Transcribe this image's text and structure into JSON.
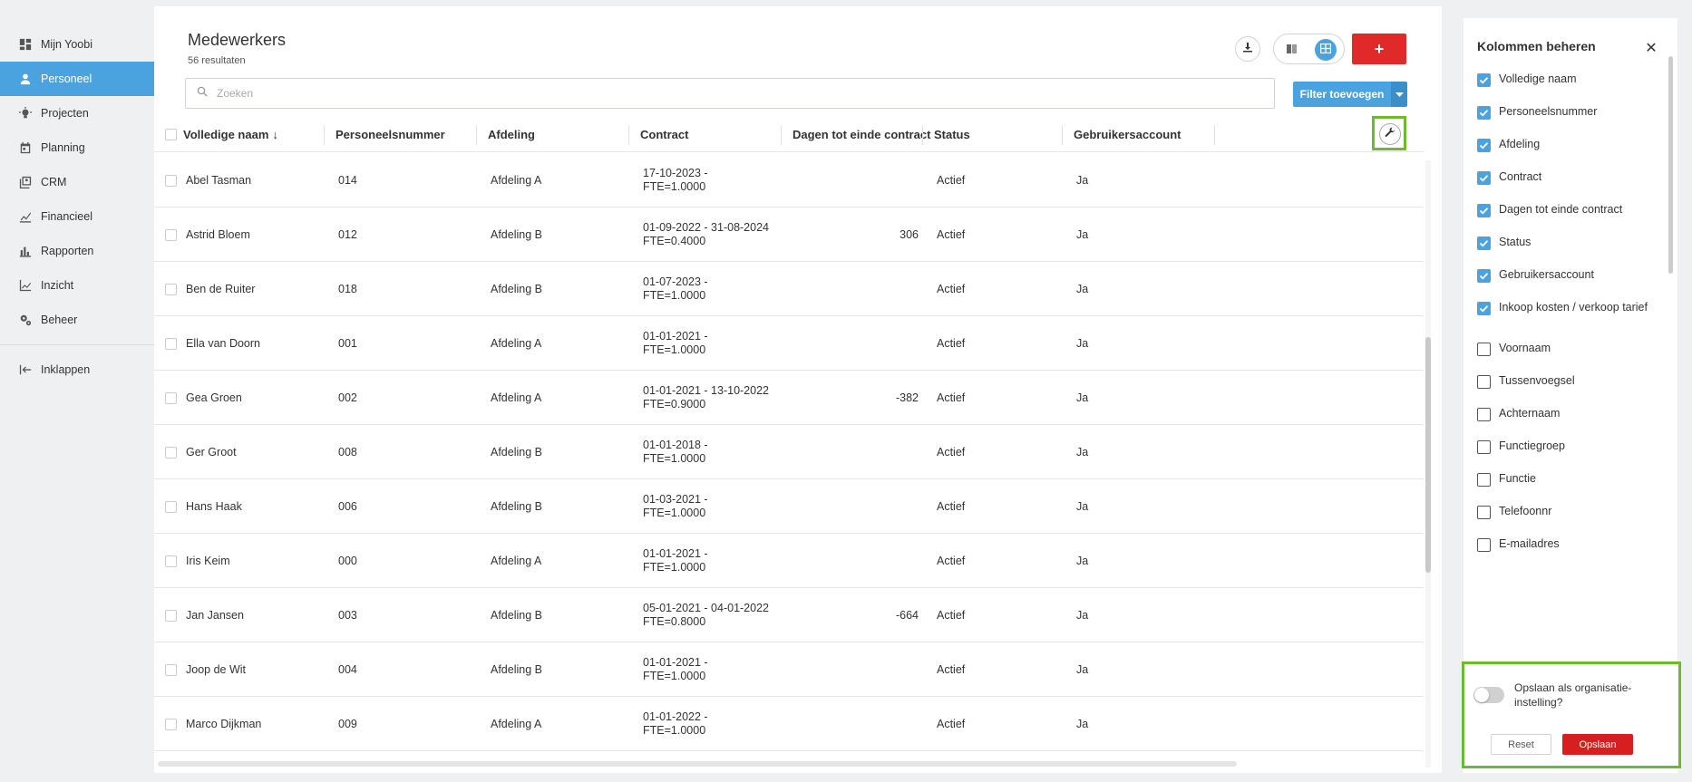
{
  "sidebar": {
    "items": [
      {
        "label": "Mijn Yoobi",
        "icon": "dashboard-icon"
      },
      {
        "label": "Personeel",
        "icon": "person-icon",
        "active": true
      },
      {
        "label": "Projecten",
        "icon": "lightbulb-icon"
      },
      {
        "label": "Planning",
        "icon": "calendar-icon"
      },
      {
        "label": "CRM",
        "icon": "contacts-icon"
      },
      {
        "label": "Financieel",
        "icon": "finance-icon"
      },
      {
        "label": "Rapporten",
        "icon": "bar-chart-icon"
      },
      {
        "label": "Inzicht",
        "icon": "line-chart-icon"
      },
      {
        "label": "Beheer",
        "icon": "gears-icon"
      }
    ],
    "collapse_label": "Inklappen"
  },
  "header": {
    "title": "Medewerkers",
    "results": "56 resultaten",
    "add_label": "+",
    "filter_label": "Filter toevoegen"
  },
  "search": {
    "placeholder": "Zoeken",
    "value": ""
  },
  "table": {
    "columns": [
      "Volledige naam",
      "Personeelsnummer",
      "Afdeling",
      "Contract",
      "Dagen tot einde contract",
      "Status",
      "Gebruikersaccount"
    ],
    "sort_indicator": "↓",
    "rows": [
      {
        "name": "Abel Tasman",
        "number": "014",
        "dept": "Afdeling A",
        "contract1": "17-10-2023 -",
        "contract2": "FTE=1.0000",
        "days": "",
        "status": "Actief",
        "account": "Ja"
      },
      {
        "name": "Astrid Bloem",
        "number": "012",
        "dept": "Afdeling B",
        "contract1": "01-09-2022 - 31-08-2024",
        "contract2": "FTE=0.4000",
        "days": "306",
        "status": "Actief",
        "account": "Ja"
      },
      {
        "name": "Ben de Ruiter",
        "number": "018",
        "dept": "Afdeling B",
        "contract1": "01-07-2023 -",
        "contract2": "FTE=1.0000",
        "days": "",
        "status": "Actief",
        "account": "Ja"
      },
      {
        "name": "Ella van Doorn",
        "number": "001",
        "dept": "Afdeling A",
        "contract1": "01-01-2021 -",
        "contract2": "FTE=1.0000",
        "days": "",
        "status": "Actief",
        "account": "Ja"
      },
      {
        "name": "Gea Groen",
        "number": "002",
        "dept": "Afdeling A",
        "contract1": "01-01-2021 - 13-10-2022",
        "contract2": "FTE=0.9000",
        "days": "-382",
        "status": "Actief",
        "account": "Ja"
      },
      {
        "name": "Ger Groot",
        "number": "008",
        "dept": "Afdeling B",
        "contract1": "01-01-2018 -",
        "contract2": "FTE=1.0000",
        "days": "",
        "status": "Actief",
        "account": "Ja"
      },
      {
        "name": "Hans Haak",
        "number": "006",
        "dept": "Afdeling B",
        "contract1": "01-03-2021 -",
        "contract2": "FTE=1.0000",
        "days": "",
        "status": "Actief",
        "account": "Ja"
      },
      {
        "name": "Iris Keim",
        "number": "000",
        "dept": "Afdeling A",
        "contract1": "01-01-2021 -",
        "contract2": "FTE=1.0000",
        "days": "",
        "status": "Actief",
        "account": "Ja"
      },
      {
        "name": "Jan Jansen",
        "number": "003",
        "dept": "Afdeling B",
        "contract1": "05-01-2021 - 04-01-2022",
        "contract2": "FTE=0.8000",
        "days": "-664",
        "status": "Actief",
        "account": "Ja"
      },
      {
        "name": "Joop de Wit",
        "number": "004",
        "dept": "Afdeling B",
        "contract1": "01-01-2021 -",
        "contract2": "FTE=1.0000",
        "days": "",
        "status": "Actief",
        "account": "Ja"
      },
      {
        "name": "Marco Dijkman",
        "number": "009",
        "dept": "Afdeling A",
        "contract1": "01-01-2022 -",
        "contract2": "FTE=1.0000",
        "days": "",
        "status": "Actief",
        "account": "Ja"
      }
    ]
  },
  "panel": {
    "title": "Kolommen beheren",
    "columns": [
      {
        "label": "Volledige naam",
        "checked": true
      },
      {
        "label": "Personeelsnummer",
        "checked": true
      },
      {
        "label": "Afdeling",
        "checked": true
      },
      {
        "label": "Contract",
        "checked": true
      },
      {
        "label": "Dagen tot einde contract",
        "checked": true
      },
      {
        "label": "Status",
        "checked": true
      },
      {
        "label": "Gebruikersaccount",
        "checked": true
      },
      {
        "label": "Inkoop kosten / verkoop tarief",
        "checked": true
      },
      {
        "label": "Voornaam",
        "checked": false
      },
      {
        "label": "Tussenvoegsel",
        "checked": false
      },
      {
        "label": "Achternaam",
        "checked": false
      },
      {
        "label": "Functiegroep",
        "checked": false
      },
      {
        "label": "Functie",
        "checked": false
      },
      {
        "label": "Telefoonnr",
        "checked": false
      },
      {
        "label": "E-mailadres",
        "checked": false
      }
    ],
    "toggle_label": "Opslaan als organisatie-instelling?",
    "reset_label": "Reset",
    "save_label": "Opslaan"
  },
  "colors": {
    "accent": "#4aa3df",
    "danger": "#e02a2a",
    "highlight": "#6cba2e"
  }
}
